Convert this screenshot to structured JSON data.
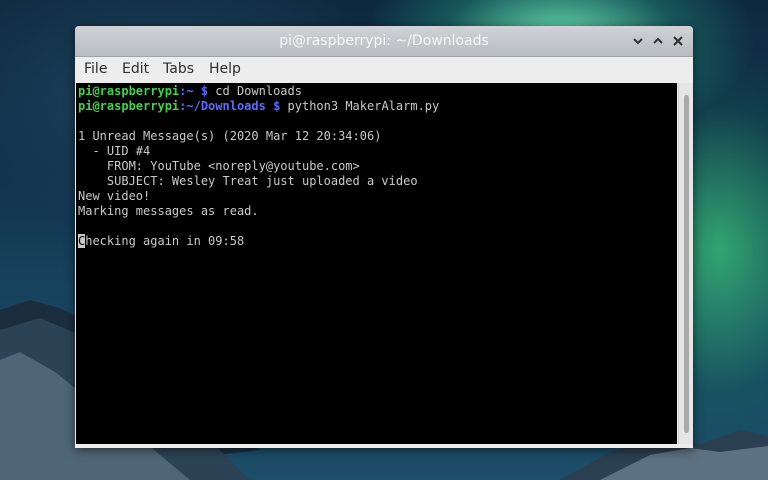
{
  "window": {
    "title": "pi@raspberrypi: ~/Downloads",
    "controls": {
      "minimize_icon": "chevron-down-icon",
      "maximize_icon": "chevron-up-icon",
      "close_icon": "close-icon"
    }
  },
  "menu": {
    "items": [
      {
        "label": "File"
      },
      {
        "label": "Edit"
      },
      {
        "label": "Tabs"
      },
      {
        "label": "Help"
      }
    ]
  },
  "terminal": {
    "colors": {
      "prompt_user": "#42d24a",
      "prompt_path": "#5c6cff",
      "text": "#c9c9c9",
      "background": "#000000"
    },
    "line1": {
      "user": "pi@raspberrypi",
      "path": ":~",
      "symbol": " $",
      "command": " cd Downloads"
    },
    "line2": {
      "user": "pi@raspberrypi",
      "path": ":~/Downloads",
      "symbol": " $",
      "command": " python3 MakerAlarm.py"
    },
    "output": [
      "1 Unread Message(s) (2020 Mar 12 20:34:06)",
      "  - UID #4",
      "    FROM: YouTube <noreply@youtube.com>",
      "    SUBJECT: Wesley Treat just uploaded a video",
      "New video!",
      "Marking messages as read."
    ],
    "status": {
      "cursor_char": "C",
      "rest": "hecking again in 09:58"
    }
  }
}
